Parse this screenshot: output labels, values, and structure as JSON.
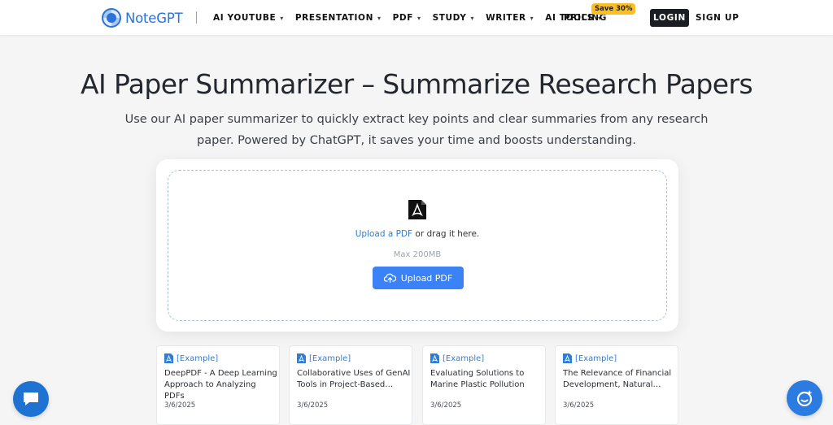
{
  "header": {
    "logo_text": "NoteGPT",
    "nav": [
      {
        "label": "AI YOUTUBE"
      },
      {
        "label": "PRESENTATION"
      },
      {
        "label": "PDF"
      },
      {
        "label": "STUDY"
      },
      {
        "label": "WRITER"
      },
      {
        "label": "AI TOOLS"
      }
    ],
    "pricing_label": "PRICING",
    "save_badge": "Save 30%",
    "login_label": "LOGIN",
    "signup_label": "SIGN UP"
  },
  "hero": {
    "title": "AI Paper Summarizer – Summarize Research Papers",
    "subtitle": "Use our AI paper summarizer to quickly extract key points and clear summaries from any research paper. Powered by ChatGPT, it saves your time and boosts understanding."
  },
  "upload": {
    "link_text": "Upload a PDF",
    "drag_text": " or drag it here.",
    "max_size": "Max 200MB",
    "button_label": "Upload PDF"
  },
  "examples": [
    {
      "tag": "[Example]",
      "title": "DeepPDF - A Deep Learning Approach to Analyzing PDFs",
      "date": "3/6/2025"
    },
    {
      "tag": "[Example]",
      "title": "Collaborative Uses of GenAI Tools in Project-Based…",
      "date": "3/6/2025"
    },
    {
      "tag": "[Example]",
      "title": "Evaluating Solutions to Marine Plastic Pollution",
      "date": "3/6/2025"
    },
    {
      "tag": "[Example]",
      "title": "The Relevance of Financial Development, Natural…",
      "date": "3/6/2025"
    }
  ],
  "icons": {
    "logo": "notegpt-logo-icon",
    "pdf": "pdf-icon",
    "upload": "cloud-upload-icon",
    "chat": "chat-icon",
    "assistant": "assistant-icon"
  },
  "colors": {
    "brand": "#2a73d9",
    "primary_button": "#3b82f6",
    "badge": "#fbbf24",
    "login_bg": "#1a1d21",
    "link": "#2f7ed6"
  }
}
